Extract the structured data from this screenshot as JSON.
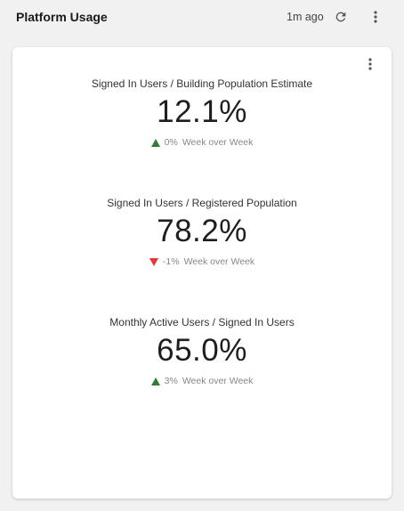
{
  "header": {
    "title": "Platform Usage",
    "updated": "1m ago",
    "refresh_icon": "refresh-icon",
    "more_icon": "more-vertical-icon"
  },
  "card": {
    "more_icon": "more-vertical-icon",
    "metrics": [
      {
        "label": "Signed In Users / Building Population Estimate",
        "value": "12.1%",
        "delta": "0%",
        "trend": "up",
        "period": "Week over Week"
      },
      {
        "label": "Signed In Users / Registered Population",
        "value": "78.2%",
        "delta": "-1%",
        "trend": "down",
        "period": "Week over Week"
      },
      {
        "label": "Monthly Active Users / Signed In Users",
        "value": "65.0%",
        "delta": "3%",
        "trend": "up",
        "period": "Week over Week"
      }
    ]
  },
  "colors": {
    "up": "#2e7d32",
    "down": "#e53935",
    "background": "#f1f1f1",
    "card": "#ffffff"
  }
}
